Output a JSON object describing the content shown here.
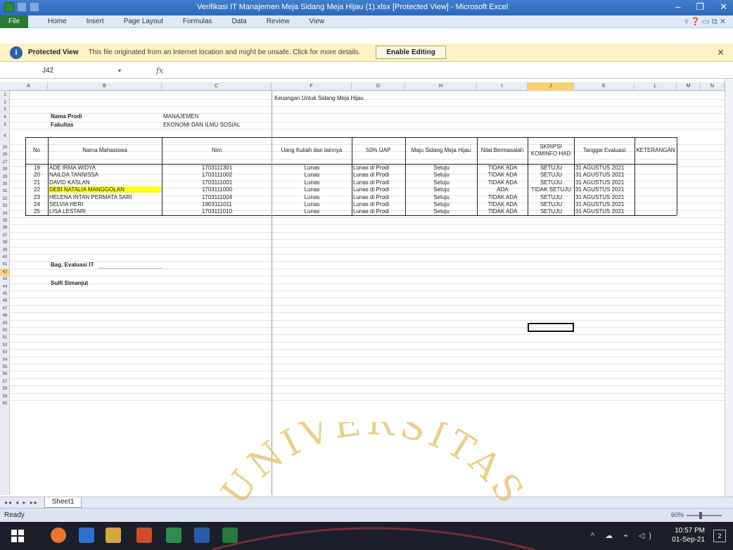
{
  "window": {
    "title": "Verifikasi IT Manajemen Meja Sidang Meja Hijau (1).xlsx  [Protected View] - Microsoft Excel",
    "minimize": "–",
    "maximize": "❐",
    "close": "✕"
  },
  "menu": {
    "file": "File",
    "items": [
      "Home",
      "Insert",
      "Page Layout",
      "Formulas",
      "Data",
      "Review",
      "View"
    ],
    "help": "▿ ❓ ▭ ⧉ ✕"
  },
  "protected_view": {
    "icon": "i",
    "title": "Protected View",
    "message": "This file originated from an Internet location and might be unsafe. Click for more details.",
    "button": "Enable Editing",
    "close": "✕"
  },
  "formula_bar": {
    "name_box": "J42",
    "dropdown": "▾",
    "fx": "fx"
  },
  "columns": [
    "A",
    "B",
    "C",
    "F",
    "G",
    "H",
    "I",
    "J",
    "K",
    "L",
    "M",
    "N"
  ],
  "rows": [
    "1",
    "2",
    "3",
    "4",
    "5",
    "6",
    "25",
    "26",
    "27",
    "28",
    "29",
    "30",
    "31",
    "32",
    "33",
    "34",
    "35",
    "36",
    "37",
    "38",
    "39",
    "40",
    "41",
    "42",
    "43",
    "44",
    "45",
    "46",
    "47",
    "48",
    "49",
    "50",
    "51",
    "52",
    "53",
    "54",
    "55",
    "56",
    "57",
    "58",
    "59",
    "60"
  ],
  "sheet": {
    "heading": "Keuangan Untuk Sidang Meja Hijau",
    "prodi_label": "Nama Prodi",
    "prodi_value": "MANAJEMEN",
    "fakultas_label": "Fakultas",
    "fakultas_value": "EKONOMI DAN ILMU SOSIAL",
    "table_headers": [
      "No",
      "Nama Mahasiswa",
      "Nim",
      "Uang Kuliah dan lainnya",
      "50% UAP",
      "Maju Sidang Meja Hijau",
      "Nilai Bermasalah",
      "SKRIPSI KOMINFO HAD",
      "Tanggal Evaluasi",
      "KETERANGAN"
    ],
    "table_rows": [
      [
        "19",
        "ADE IRMA WIDYA",
        "1703111301",
        "Lunas",
        "Lunas di Prodi",
        "Setuju",
        "TIDAK ADA",
        "SETUJU",
        "31 AGUSTUS 2021",
        ""
      ],
      [
        "20",
        "NAILDA TANNISSA",
        "1703111002",
        "Lunas",
        "Lunas di Prodi",
        "Setuju",
        "TIDAK ADA",
        "SETUJU",
        "31 AGUSTUS 2021",
        ""
      ],
      [
        "21",
        "DAVID KASLAN",
        "1703111001",
        "Lunas",
        "Lunas di Prodi",
        "Setuju",
        "TIDAK ADA",
        "SETUJU",
        "31 AGUSTUS 2021",
        ""
      ],
      [
        "22",
        "DEBI NATALIA MANGGOLAN",
        "1703111000",
        "Lunas",
        "Lunas di Prodi",
        "Setuju",
        "ADA",
        "TIDAK SETUJU",
        "31 AGUSTUS 2021",
        ""
      ],
      [
        "23",
        "HELENA INTAN PERMATA SARI",
        "1703111004",
        "Lunas",
        "Lunas di Prodi",
        "Setuju",
        "TIDAK ADA",
        "SETUJU",
        "31 AGUSTUS 2021",
        ""
      ],
      [
        "24",
        "SELVIA HERI",
        "1903111011",
        "Lunas",
        "Lunas di Prodi",
        "Setuju",
        "TIDAK ADA",
        "SETUJU",
        "31 AGUSTUS 2021",
        ""
      ],
      [
        "25",
        "LISA LESTARI",
        "1703111010",
        "Lunas",
        "Lunas di Prodi",
        "Setuju",
        "TIDAK ADA",
        "SETUJU",
        "31 AGUSTUS 2021",
        ""
      ]
    ],
    "sign_title": "Bag. Evaluasi IT",
    "sign_name": "Sulfi Simanjut"
  },
  "sheet_tab": "Sheet1",
  "nav_buttons": "◂◂ ◂ ▸ ▸▸",
  "status": {
    "ready": "Ready",
    "zoom": "60%"
  },
  "taskbar": {
    "time": "10:57 PM",
    "date": "01-Sep-21",
    "tray": "^ ☁ ⌁ ◁)",
    "notifications": "2"
  },
  "watermark_text": "UNIVERSITAS",
  "colors": {
    "title_bar": "#2d68b8",
    "file_tab": "#2a7a32",
    "protected_bar": "#fdf3c3",
    "highlight": "#ffff2a",
    "selected_header": "#f7d27a",
    "watermark": "#d9b24a"
  }
}
